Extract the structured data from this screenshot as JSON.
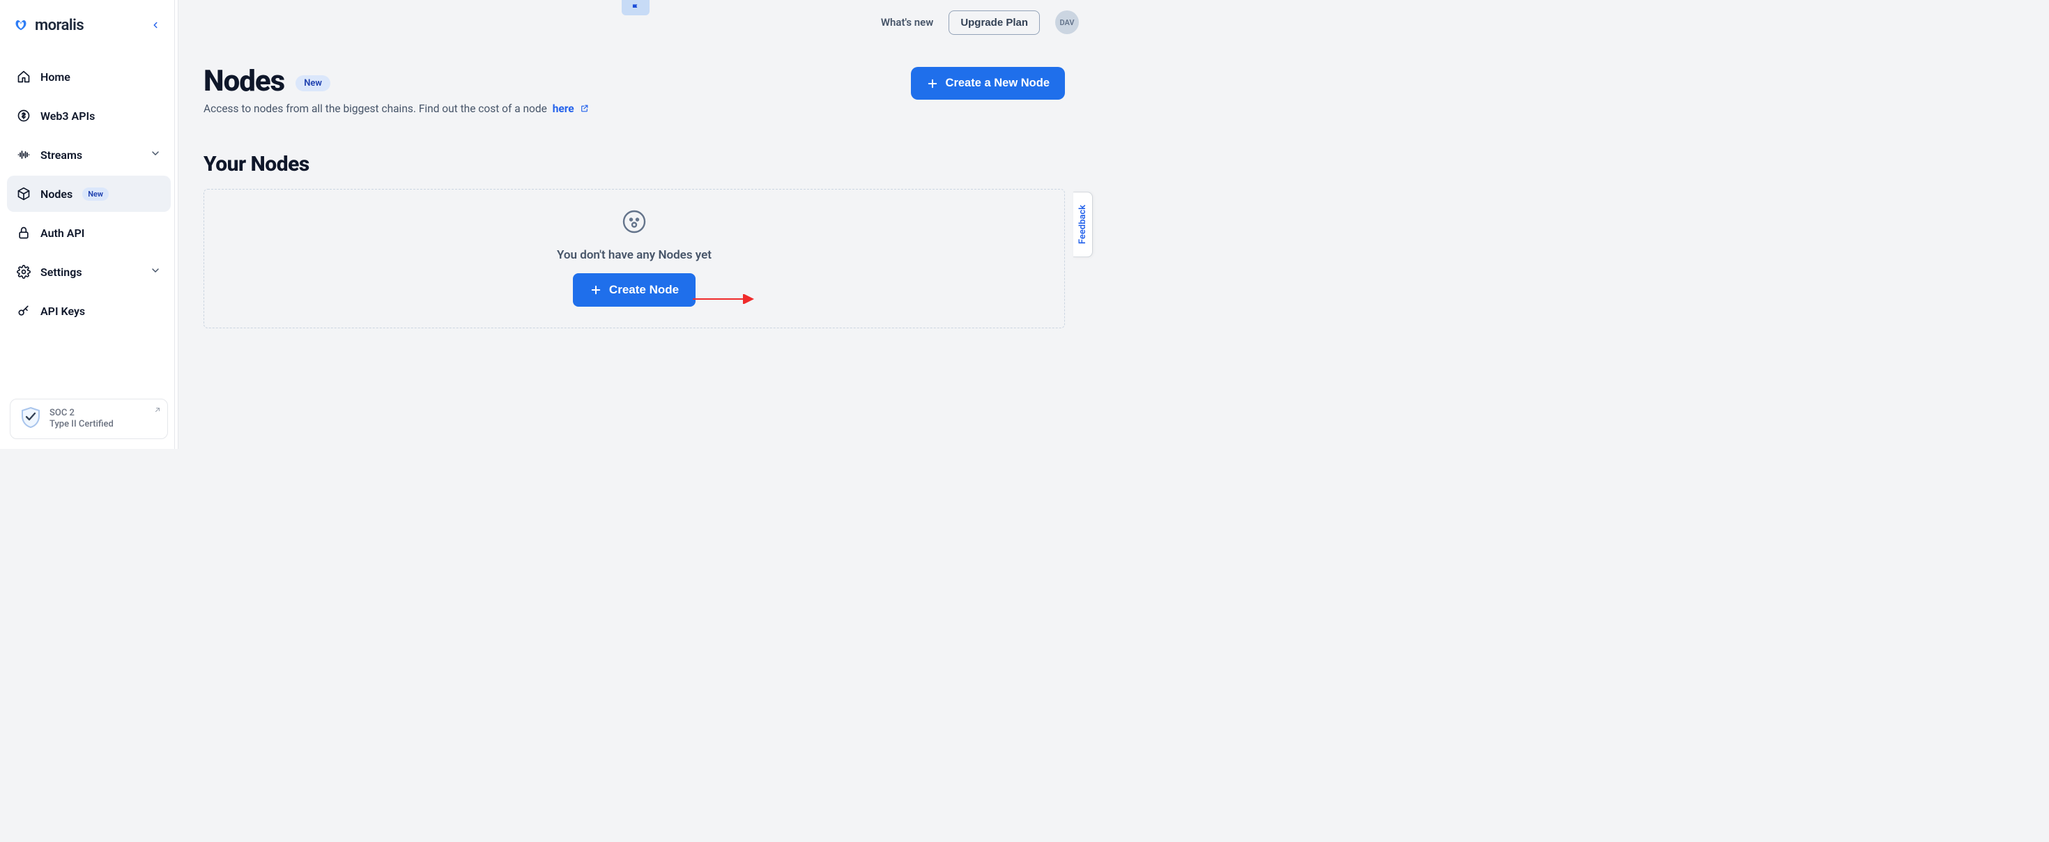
{
  "brand": {
    "name": "moralis"
  },
  "sidebar": {
    "items": [
      {
        "label": "Home",
        "icon": "home"
      },
      {
        "label": "Web3 APIs",
        "icon": "dollar-circle"
      },
      {
        "label": "Streams",
        "icon": "waveform",
        "expandable": true
      },
      {
        "label": "Nodes",
        "icon": "cube",
        "badge": "New",
        "active": true
      },
      {
        "label": "Auth API",
        "icon": "lock"
      },
      {
        "label": "Settings",
        "icon": "gear",
        "expandable": true
      },
      {
        "label": "API Keys",
        "icon": "key"
      }
    ],
    "soc2": {
      "line1": "SOC 2",
      "line2": "Type II Certified"
    }
  },
  "topbar": {
    "whats_new": "What's new",
    "upgrade": "Upgrade Plan",
    "avatar_initials": "DAV"
  },
  "page": {
    "title": "Nodes",
    "title_badge": "New",
    "subtitle_prefix": "Access to nodes from all the biggest chains. Find out the cost of a node",
    "subtitle_link": "here",
    "create_new_node": "Create a New Node",
    "your_nodes": "Your Nodes",
    "empty_text": "You don't have any Nodes yet",
    "create_node": "Create Node"
  },
  "feedback": "Feedback"
}
